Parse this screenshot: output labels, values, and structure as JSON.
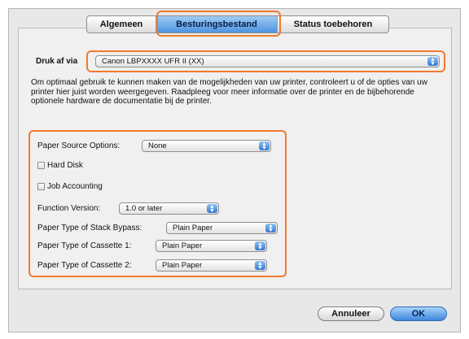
{
  "tabs": [
    {
      "label": "Algemeen"
    },
    {
      "label": "Besturingsbestand",
      "selected": true
    },
    {
      "label": "Status toebehoren"
    }
  ],
  "print_via": {
    "label": "Druk af via",
    "value": "Canon LBPXXXX UFR II (XX)"
  },
  "description": "Om optimaal gebruik te kunnen maken van de mogelijkheden van uw printer, controleert u of de opties van uw printer hier juist worden weergegeven. Raadpleeg voor meer informatie over de printer en de bijbehorende optionele hardware de documentatie bij de printer.",
  "options": {
    "paper_source": {
      "label": "Paper Source Options:",
      "value": "None"
    },
    "hard_disk": {
      "label": "Hard Disk",
      "checked": false
    },
    "job_accounting": {
      "label": "Job Accounting",
      "checked": false
    },
    "function_version": {
      "label": "Function Version:",
      "value": "1.0 or later"
    },
    "stack_bypass": {
      "label": "Paper Type of Stack Bypass:",
      "value": "Plain Paper"
    },
    "cassette1": {
      "label": "Paper Type of Cassette 1:",
      "value": "Plain Paper"
    },
    "cassette2": {
      "label": "Paper Type of Cassette 2:",
      "value": "Plain Paper"
    }
  },
  "buttons": {
    "cancel": "Annuleer",
    "ok": "OK"
  },
  "colors": {
    "highlight": "#f07a2e",
    "accent_blue": "#4d94e0"
  }
}
